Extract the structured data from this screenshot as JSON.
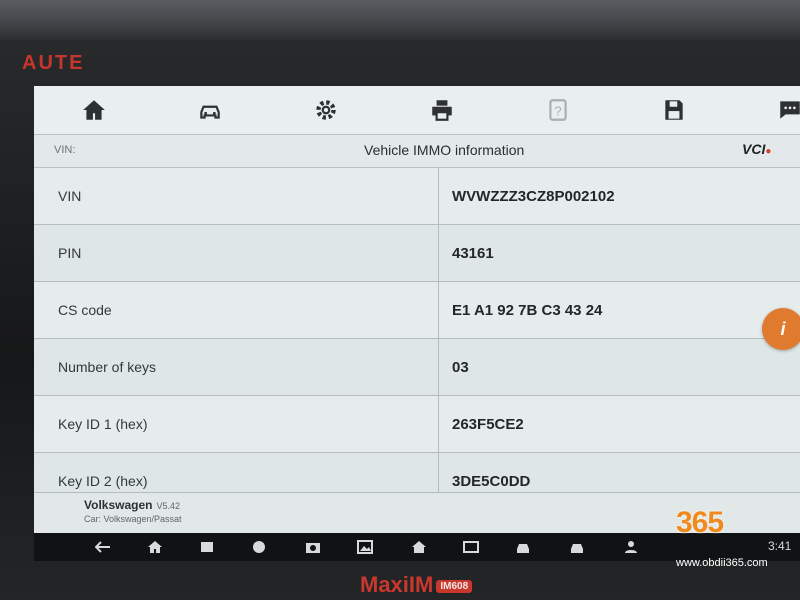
{
  "device": {
    "brand_top": "AUTE",
    "brand_bottom": "MaxiIM",
    "model_tag": "IM608"
  },
  "toolbar": {
    "buttons": [
      "home-icon",
      "vehicle-icon",
      "settings-icon",
      "print-icon",
      "help-icon",
      "save-icon",
      "chat-icon"
    ]
  },
  "header": {
    "left_label": "VIN:",
    "title": "Vehicle IMMO information",
    "vci": "VCI"
  },
  "table": {
    "rows": [
      {
        "label": "VIN",
        "value": "WVWZZZ3CZ8P002102"
      },
      {
        "label": "PIN",
        "value": "43161"
      },
      {
        "label": "CS code",
        "value": "E1 A1 92 7B C3 43 24"
      },
      {
        "label": "Number of keys",
        "value": "03"
      },
      {
        "label": "Key ID 1 (hex)",
        "value": "263F5CE2"
      },
      {
        "label": "Key ID 2 (hex)",
        "value": "3DE5C0DD"
      }
    ]
  },
  "info_button": {
    "label": "i"
  },
  "footer": {
    "make": "Volkswagen",
    "version": "V5.42",
    "car": "Car: Volkswagen/Passat"
  },
  "navbar": {
    "time": "3:41"
  },
  "watermark": {
    "logo": "365",
    "url": "www.obdii365.com"
  },
  "colors": {
    "accent": "#e07a2e",
    "brand_red": "#c9372d",
    "screen_bg": "#dfe7e6"
  }
}
